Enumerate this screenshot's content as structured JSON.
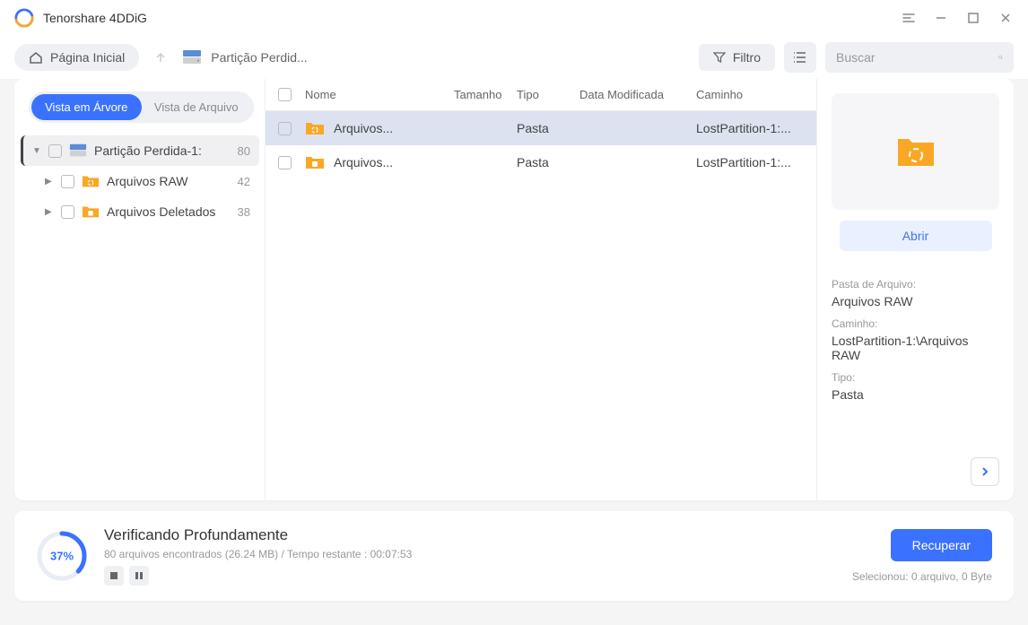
{
  "titlebar": {
    "title": "Tenorshare 4DDiG"
  },
  "toolbar": {
    "home_label": "Página Inicial",
    "breadcrumb_text": "Partição Perdid...",
    "filter_label": "Filtro",
    "search_placeholder": "Buscar"
  },
  "sidebar": {
    "tab_tree": "Vista em Árvore",
    "tab_file": "Vista de Arquivo",
    "items": [
      {
        "label": "Partição Perdida-1:",
        "count": "80"
      },
      {
        "label": "Arquivos RAW",
        "count": "42"
      },
      {
        "label": "Arquivos Deletados",
        "count": "38"
      }
    ]
  },
  "columns": {
    "name": "Nome",
    "size": "Tamanho",
    "type": "Tipo",
    "date": "Data Modificada",
    "path": "Caminho"
  },
  "rows": [
    {
      "name": "Arquivos...",
      "type": "Pasta",
      "path": "LostPartition-1:..."
    },
    {
      "name": "Arquivos...",
      "type": "Pasta",
      "path": "LostPartition-1:..."
    }
  ],
  "details": {
    "open_label": "Abrir",
    "folder_label": "Pasta de Arquivo:",
    "folder_value": "Arquivos RAW",
    "path_label": "Caminho:",
    "path_value": "LostPartition-1:\\Arquivos RAW",
    "type_label": "Tipo:",
    "type_value": "Pasta"
  },
  "status": {
    "percent": "37%",
    "title": "Verificando Profundamente",
    "sub": "80 arquivos encontrados (26.24 MB) /  Tempo restante : 00:07:53",
    "recover_label": "Recuperar",
    "selection": "Selecionou: 0 arquivo, 0 Byte"
  }
}
